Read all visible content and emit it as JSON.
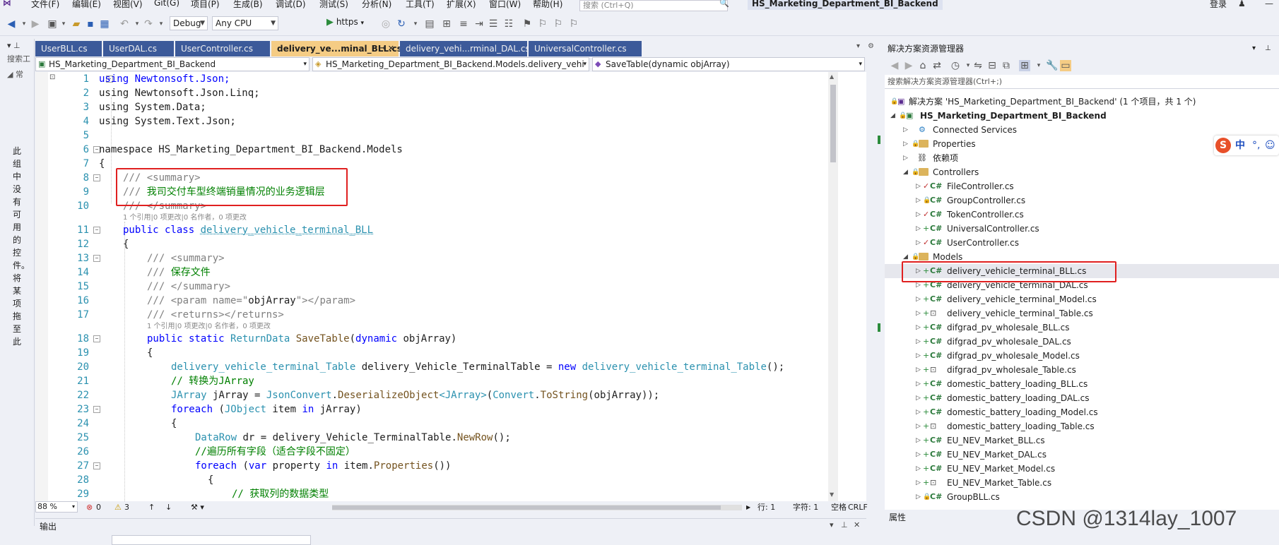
{
  "menu": {
    "items": [
      "文件(F)",
      "编辑(E)",
      "视图(V)",
      "Git(G)",
      "项目(P)",
      "生成(B)",
      "调试(D)",
      "测试(S)",
      "分析(N)",
      "工具(T)",
      "扩展(X)",
      "窗口(W)",
      "帮助(H)"
    ],
    "search_placeholder": "搜索 (Ctrl+Q)",
    "project_title": "HS_Marketing_Department_BI_Backend",
    "login": "登录"
  },
  "toolbar": {
    "config": "Debug",
    "platform": "Any CPU",
    "run_label": "https"
  },
  "toolbox": {
    "search_label": "搜索工",
    "header": "常",
    "vertical_text": "此组中没有可用的控件。将某项拖至此"
  },
  "tabs": [
    {
      "label": "UserBLL.cs",
      "active": false
    },
    {
      "label": "UserDAL.cs",
      "active": false
    },
    {
      "label": "UserController.cs",
      "active": false
    },
    {
      "label": "delivery_ve...minal_BLL.cs",
      "active": true
    },
    {
      "label": "delivery_vehi...rminal_DAL.cs",
      "active": false
    },
    {
      "label": "UniversalController.cs",
      "active": false
    }
  ],
  "navbar": {
    "project": "HS_Marketing_Department_BI_Backend",
    "class": "HS_Marketing_Department_BI_Backend.Models.delivery_vehi",
    "member": "SaveTable(dynamic objArray)"
  },
  "code": {
    "line1": "using Newtonsoft.Json;",
    "line2": "using Newtonsoft.Json.Linq;",
    "line3": "using System.Data;",
    "line4": "using System.Text.Json;",
    "line6": "namespace HS_Marketing_Department_BI_Backend.Models",
    "line7": "{",
    "line8": "/// <summary>",
    "line9_prefix": "/// ",
    "line9_text": "我司交付车型终端销量情况的业务逻辑层",
    "line10": "/// </summary>",
    "lens1": "1 个引用|0 项更改|0 名作者，0 项更改",
    "line11_kw": "public class",
    "line11_name": "delivery_vehicle_terminal_BLL",
    "line12": "{",
    "line13": "/// <summary>",
    "line14_prefix": "/// ",
    "line14_text": "保存文件",
    "line15": "/// </summary>",
    "line16_a": "/// <param name=\"",
    "line16_b": "objArray",
    "line16_c": "\"></param>",
    "line17": "/// <returns></returns>",
    "lens2": "1 个引用|0 项更改|0 名作者，0 项更改",
    "line18_kw": "public static",
    "line18_type": "ReturnData",
    "line18_fn": "SaveTable",
    "line18_paren": "(",
    "line18_kw2": "dynamic",
    "line18_rest": " objArray)",
    "line19": "{",
    "line20_type": "delivery_vehicle_terminal_Table",
    "line20_mid": " delivery_Vehicle_TerminalTable = ",
    "line20_kw": "new",
    "line20_type2": "delivery_vehicle_terminal_Table",
    "line20_end": "();",
    "line21": "// 转换为JArray",
    "line22_type": "JArray",
    "line22_mid": " jArray = ",
    "line22_cls": "JsonConvert",
    "line22_dot": ".",
    "line22_fn": "DeserializeObject",
    "line22_gen": "<JArray>",
    "line22_p": "(",
    "line22_cls2": "Convert",
    "line22_fn2": "ToString",
    "line22_end": "(objArray));",
    "line23_kw": "foreach",
    "line23_a": " (",
    "line23_type": "JObject",
    "line23_b": " item ",
    "line23_kw2": "in",
    "line23_c": " jArray)",
    "line24": "{",
    "line25_type": "DataRow",
    "line25_mid": " dr = delivery_Vehicle_TerminalTable.",
    "line25_fn": "NewRow",
    "line25_end": "();",
    "line26": "//遍历所有字段（适合字段不固定）",
    "line27_kw": "foreach",
    "line27_a": " (",
    "line27_kw2": "var",
    "line27_b": " property ",
    "line27_kw3": "in",
    "line27_c": " item.",
    "line27_fn": "Properties",
    "line27_end": "())",
    "line28": "{",
    "line29": "// 获取列的数据类型"
  },
  "line_numbers": [
    "1",
    "2",
    "3",
    "4",
    "5",
    "6",
    "7",
    "8",
    "9",
    "10",
    "11",
    "12",
    "13",
    "14",
    "15",
    "16",
    "17",
    "18",
    "19",
    "20",
    "21",
    "22",
    "23",
    "24",
    "25",
    "26",
    "27",
    "28",
    "29"
  ],
  "status": {
    "zoom": "88 %",
    "errors": "0",
    "warnings": "3",
    "line": "行: 1",
    "col": "字符: 1",
    "space": "空格",
    "eol": "CRLF"
  },
  "output": {
    "title": "输出"
  },
  "solution_explorer": {
    "title": "解决方案资源管理器",
    "search_placeholder": "搜索解决方案资源管理器(Ctrl+;)",
    "solution": "解决方案 'HS_Marketing_Department_BI_Backend' (1 个项目，共 1 个)",
    "project": "HS_Marketing_Department_BI_Backend",
    "connected": "Connected Services",
    "properties": "Properties",
    "deps": "依赖项",
    "controllers": "Controllers",
    "controller_files": [
      "FileController.cs",
      "GroupController.cs",
      "TokenController.cs",
      "UniversalController.cs",
      "UserController.cs"
    ],
    "models": "Models",
    "model_files": [
      "delivery_vehicle_terminal_BLL.cs",
      "delivery_vehicle_terminal_DAL.cs",
      "delivery_vehicle_terminal_Model.cs",
      "delivery_vehicle_terminal_Table.cs",
      "difgrad_pv_wholesale_BLL.cs",
      "difgrad_pv_wholesale_DAL.cs",
      "difgrad_pv_wholesale_Model.cs",
      "difgrad_pv_wholesale_Table.cs",
      "domestic_battery_loading_BLL.cs",
      "domestic_battery_loading_DAL.cs",
      "domestic_battery_loading_Model.cs",
      "domestic_battery_loading_Table.cs",
      "EU_NEV_Market_BLL.cs",
      "EU_NEV_Market_DAL.cs",
      "EU_NEV_Market_Model.cs",
      "EU_NEV_Market_Table.cs",
      "GroupBLL.cs"
    ]
  },
  "properties_panel": {
    "title": "属性"
  },
  "ime": {
    "s": "S",
    "zh": "中",
    "p": "°,",
    "d": "☺"
  },
  "watermark": "CSDN @1314lay_1007"
}
